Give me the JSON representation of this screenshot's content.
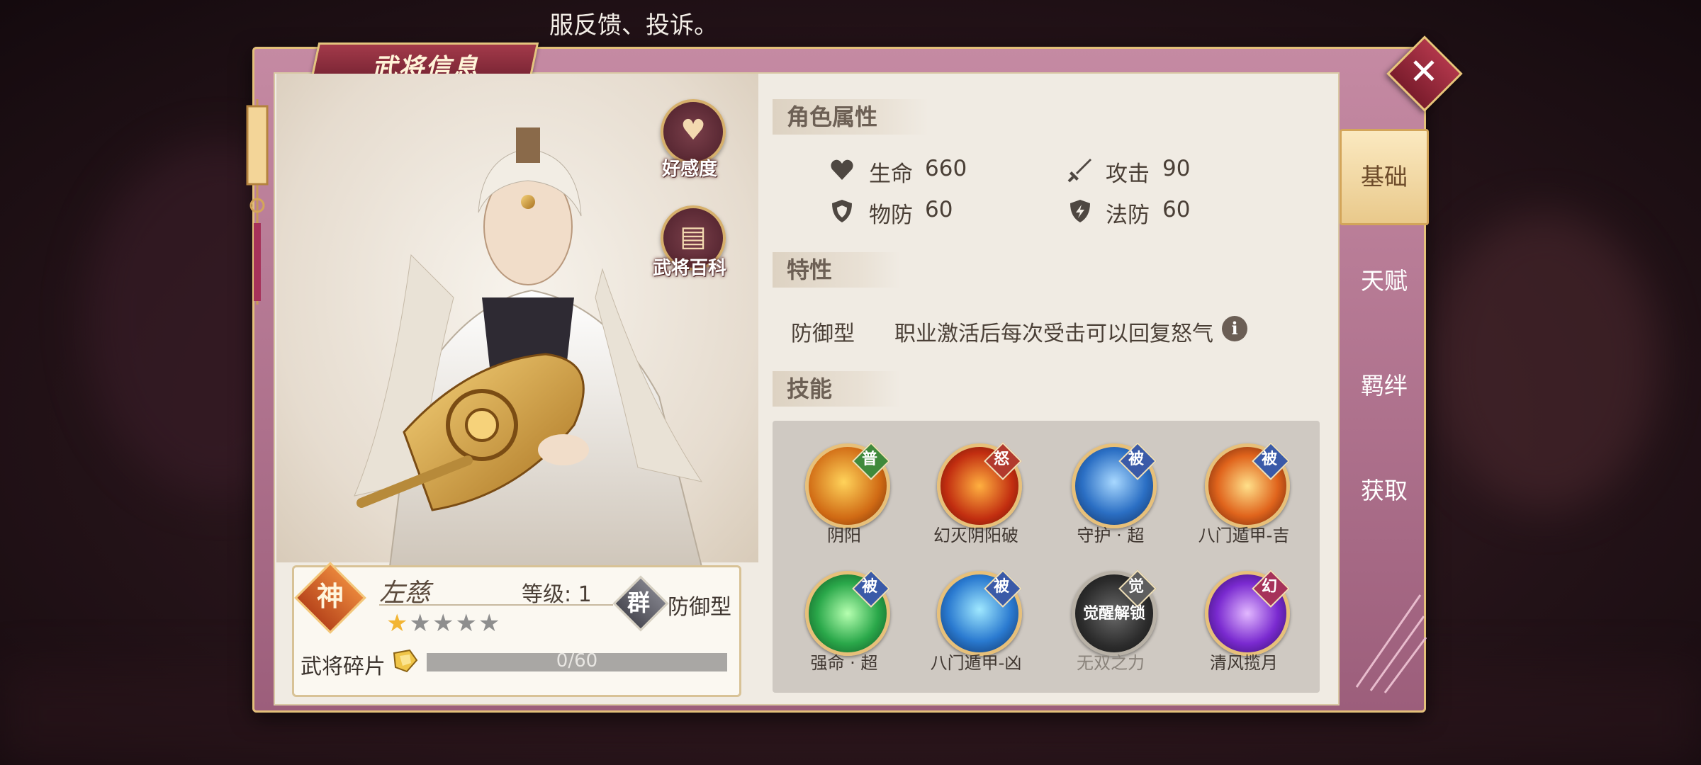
{
  "notice": "服反馈、投诉。",
  "window": {
    "title": "武将信息",
    "close_label": "✕"
  },
  "side_buttons": {
    "favor": "好感度",
    "encyclopedia": "武将百科"
  },
  "hero": {
    "rank_badge": "神",
    "name": "左慈",
    "level": "等级: 1",
    "stars_lit": 1,
    "stars_total": 5,
    "faction": "群",
    "class": "防御型",
    "fragments_label": "武将碎片",
    "fragments_progress": "0/60"
  },
  "attributes": {
    "heading": "角色属性",
    "items": [
      {
        "label": "生命",
        "value": "660",
        "icon": "heart-icon"
      },
      {
        "label": "攻击",
        "value": "90",
        "icon": "sword-icon"
      },
      {
        "label": "物防",
        "value": "60",
        "icon": "shield-icon"
      },
      {
        "label": "法防",
        "value": "60",
        "icon": "magic-shield-icon"
      }
    ]
  },
  "traits": {
    "heading": "特性",
    "name": "防御型",
    "description": "职业激活后每次受击可以回复怒气",
    "info_icon": "i"
  },
  "skills": {
    "heading": "技能",
    "items": [
      {
        "name": "阴阳",
        "tag": "普",
        "locked": false
      },
      {
        "name": "幻灭阴阳破",
        "tag": "怒",
        "locked": false
      },
      {
        "name": "守护 · 超",
        "tag": "被",
        "locked": false
      },
      {
        "name": "八门遁甲-吉",
        "tag": "被",
        "locked": false
      },
      {
        "name": "强命 · 超",
        "tag": "被",
        "locked": false
      },
      {
        "name": "八门遁甲-凶",
        "tag": "被",
        "locked": false
      },
      {
        "name": "无双之力",
        "tag": "觉",
        "locked": true,
        "lock_text": "觉醒解锁"
      },
      {
        "name": "清风揽月",
        "tag": "幻",
        "locked": false
      }
    ]
  },
  "tabs": [
    "基础",
    "天赋",
    "羁绊",
    "获取"
  ],
  "active_tab": "基础",
  "colors": {
    "frame": "#b0728f",
    "panel": "#f0ebe3",
    "gold": "#e4c47e",
    "accent_red": "#a33a4a"
  }
}
